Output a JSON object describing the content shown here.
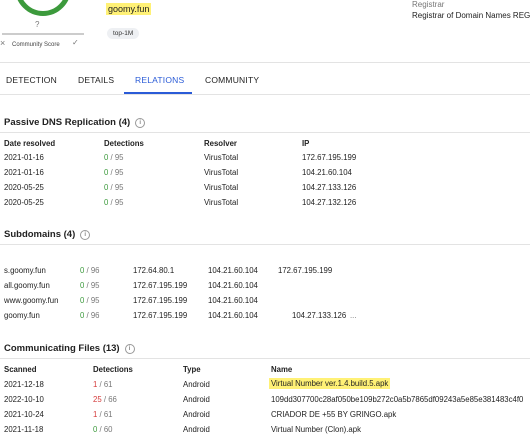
{
  "score": {
    "value": "?",
    "label": "Community Score",
    "x_icon": "×",
    "check_icon": "✓"
  },
  "domain": "goomy.fun",
  "tag": "top-1M",
  "registrar": {
    "label": "Registrar",
    "value": "Registrar of Domain Names REG"
  },
  "tabs": [
    "DETECTION",
    "DETAILS",
    "RELATIONS",
    "COMMUNITY"
  ],
  "passive_dns": {
    "title": "Passive DNS Replication (4)",
    "headers": [
      "Date resolved",
      "Detections",
      "Resolver",
      "IP"
    ],
    "rows": [
      {
        "date": "2021-01-16",
        "det": "0",
        "total": "/ 95",
        "resolver": "VirusTotal",
        "ip": "172.67.195.199"
      },
      {
        "date": "2021-01-16",
        "det": "0",
        "total": "/ 95",
        "resolver": "VirusTotal",
        "ip": "104.21.60.104"
      },
      {
        "date": "2020-05-25",
        "det": "0",
        "total": "/ 95",
        "resolver": "VirusTotal",
        "ip": "104.27.133.126"
      },
      {
        "date": "2020-05-25",
        "det": "0",
        "total": "/ 95",
        "resolver": "VirusTotal",
        "ip": "104.27.132.126"
      }
    ]
  },
  "subdomains": {
    "title": "Subdomains (4)",
    "rows": [
      {
        "name": "s.goomy.fun",
        "det": "0",
        "total": "/ 96",
        "ips": [
          "172.64.80.1",
          "104.21.60.104",
          "172.67.195.199"
        ]
      },
      {
        "name": "all.goomy.fun",
        "det": "0",
        "total": "/ 95",
        "ips": [
          "172.67.195.199",
          "104.21.60.104",
          ""
        ]
      },
      {
        "name": "www.goomy.fun",
        "det": "0",
        "total": "/ 95",
        "ips": [
          "172.67.195.199",
          "104.21.60.104",
          ""
        ]
      },
      {
        "name": "goomy.fun",
        "det": "0",
        "total": "/ 96",
        "ips": [
          "172.67.195.199",
          "104.21.60.104",
          "104.27.133.126"
        ],
        "more": "..."
      }
    ]
  },
  "comm_files": {
    "title": "Communicating Files (13)",
    "headers": [
      "Scanned",
      "Detections",
      "Type",
      "Name"
    ],
    "rows": [
      {
        "date": "2021-12-18",
        "det": "1",
        "total": "/ 61",
        "type": "Android",
        "name": "Virtual Number ver.1.4.build.5.apk",
        "highlight": true
      },
      {
        "date": "2022-10-10",
        "det": "25",
        "total": "/ 66",
        "type": "Android",
        "name": "109dd307700c28af050be109b272c0a5b7865df09243a5e85e381483c4f0",
        "highlight": false
      },
      {
        "date": "2021-10-24",
        "det": "1",
        "total": "/ 61",
        "type": "Android",
        "name": "CRIADOR DE +55 BY GRINGO.apk",
        "highlight": false
      },
      {
        "date": "2021-11-18",
        "det": "0",
        "total": "/ 60",
        "type": "Android",
        "name": "Virtual Number (Clon).apk",
        "highlight": false
      }
    ]
  },
  "colors": {
    "accent": "#2a5bd7",
    "safe": "#3c9a3c",
    "danger": "#d43a3a",
    "highlight": "#fff176"
  }
}
